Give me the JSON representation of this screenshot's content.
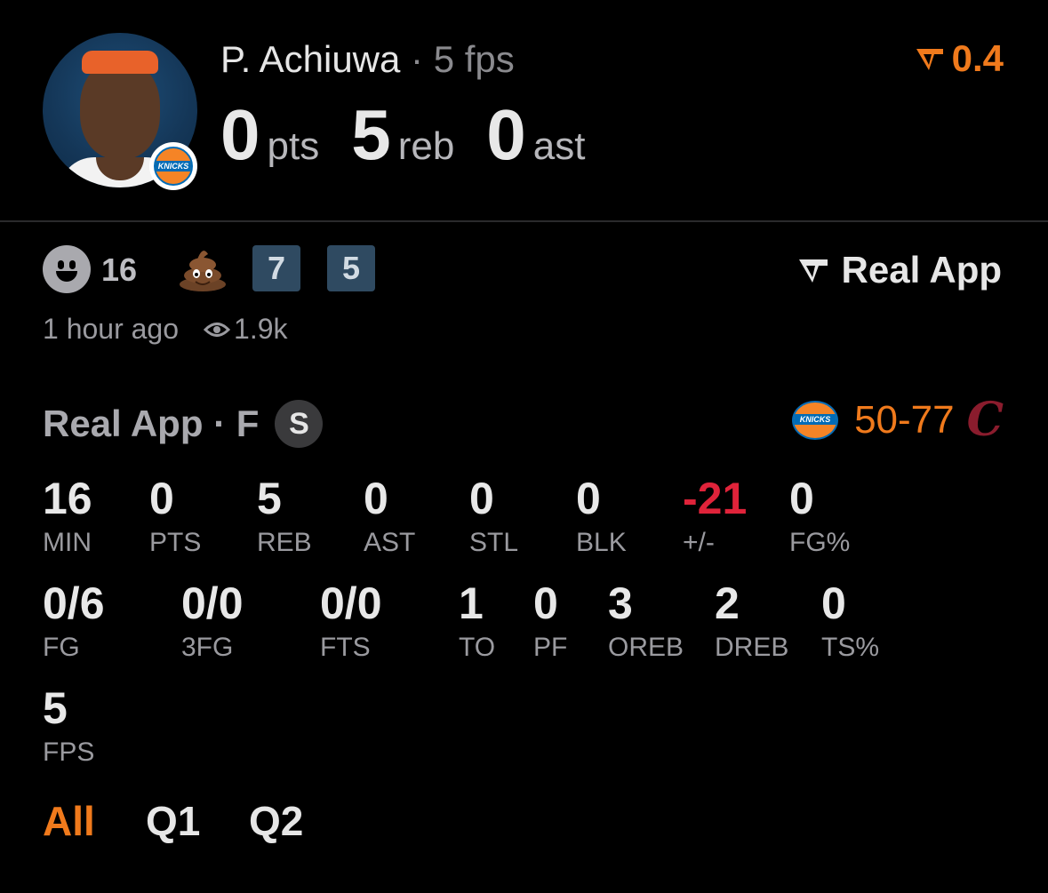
{
  "header": {
    "player_name": "P. Achiuwa",
    "separator": "·",
    "fps_text": "5 fps",
    "pts_value": "0",
    "pts_unit": "pts",
    "reb_value": "5",
    "reb_unit": "reb",
    "ast_value": "0",
    "ast_unit": "ast",
    "rating": "0.4",
    "rating_icon": "real-app-logo-icon",
    "team_logo_text": "KNICKS"
  },
  "reactions": {
    "smile_count": "16",
    "tag_a": "7",
    "tag_b": "5"
  },
  "brand": {
    "label": "Real App"
  },
  "meta": {
    "time": "1 hour ago",
    "views": "1.9k"
  },
  "game": {
    "title": "Real App · F",
    "status_badge": "S",
    "score": "50-77",
    "away_logo_text": "KNICKS",
    "home_logo": "C"
  },
  "stats_row1": [
    {
      "value": "16",
      "label": "MIN"
    },
    {
      "value": "0",
      "label": "PTS"
    },
    {
      "value": "5",
      "label": "REB"
    },
    {
      "value": "0",
      "label": "AST"
    },
    {
      "value": "0",
      "label": "STL"
    },
    {
      "value": "0",
      "label": "BLK"
    },
    {
      "value": "-21",
      "label": "+/-"
    },
    {
      "value": "0",
      "label": "FG%"
    }
  ],
  "stats_row2": [
    {
      "value": "0/6",
      "label": "FG"
    },
    {
      "value": "0/0",
      "label": "3FG"
    },
    {
      "value": "0/0",
      "label": "FTS"
    },
    {
      "value": "1",
      "label": "TO"
    },
    {
      "value": "0",
      "label": "PF"
    },
    {
      "value": "3",
      "label": "OREB"
    },
    {
      "value": "2",
      "label": "DREB"
    },
    {
      "value": "0",
      "label": "TS%"
    }
  ],
  "stats_row3": [
    {
      "value": "5",
      "label": "FPS"
    }
  ],
  "tabs": [
    {
      "label": "All",
      "active": true
    },
    {
      "label": "Q1",
      "active": false
    },
    {
      "label": "Q2",
      "active": false
    }
  ],
  "colors": {
    "accent": "#f07a1c",
    "negative": "#e0233a",
    "tag_bg": "#2f4a61"
  }
}
